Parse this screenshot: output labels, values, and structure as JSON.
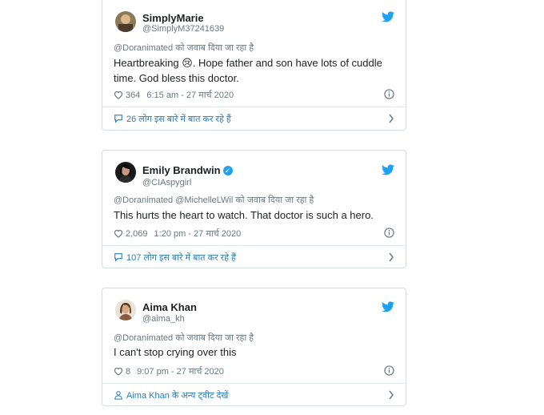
{
  "tweets": [
    {
      "name": "SimplyMarie",
      "handle": "@SimplyM37241639",
      "reply_to": "@Doranimated को जवाब दिया जा रहा है",
      "text_line1": "Heartbreaking 😢.   Hope father and son have lots of cuddle",
      "text_line2": "time.  God bless this doctor.",
      "likes": "364",
      "timestamp": "6:15 am - 27 मार्च 2020",
      "footer": "26 लोग इस बारे में बात कर रहे हैं",
      "footer_icon": "comment-icon",
      "verified": false
    },
    {
      "name": "Emily Brandwin",
      "handle": "@CIAspygirl",
      "reply_to": "@Doranimated @MichelleLWil को जवाब दिया जा रहा है",
      "text_line1": "This hurts the heart to watch. That doctor is such a hero.",
      "text_line2": "",
      "likes": "2,069",
      "timestamp": "1:20 pm - 27 मार्च 2020",
      "footer": "107 लोग इस बारे में बात कर रहे हैं",
      "footer_icon": "comment-icon",
      "verified": true
    },
    {
      "name": "Aima Khan",
      "handle": "@aima_kh",
      "reply_to": "@Doranimated को जवाब दिया जा रहा है",
      "text_line1": "I can't stop crying over this",
      "text_line2": "",
      "likes": "8",
      "timestamp": "9:07 pm - 27 मार्च 2020",
      "footer": "Aima Khan के अन्य ट्वीट देखें",
      "footer_icon": "person-icon",
      "verified": false
    }
  ],
  "colors": {
    "twitter_blue": "#1da1f2",
    "link_blue": "#2b7bb9",
    "muted": "#697882",
    "border": "#d4dbe1"
  }
}
